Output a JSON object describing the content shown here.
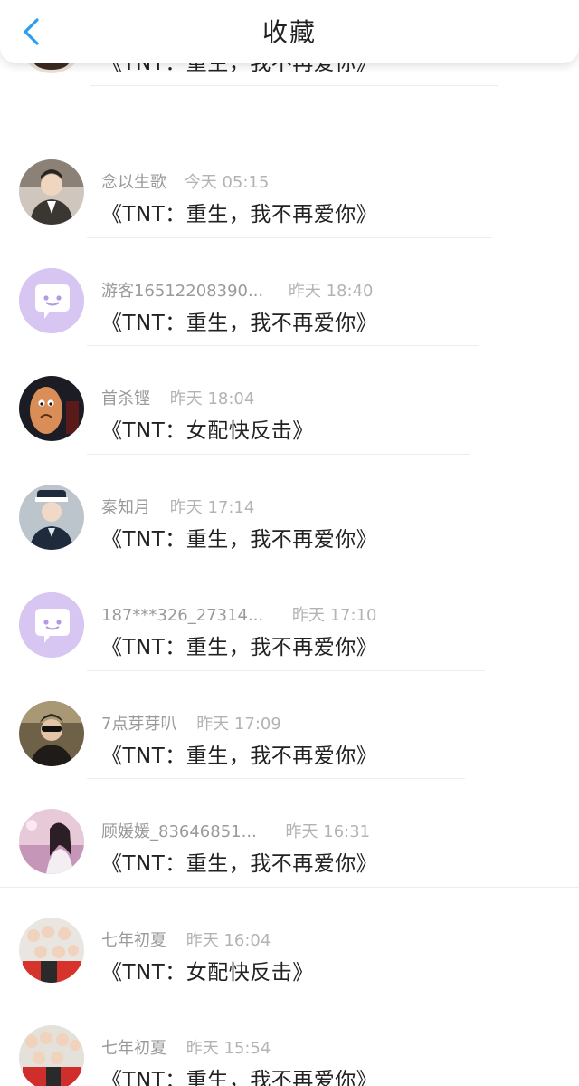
{
  "header": {
    "title": "收藏",
    "back_icon": "chevron-left-icon",
    "accent_color": "#2a9df4"
  },
  "list": [
    {
      "name": "",
      "time": "",
      "title": "《TNT：重生，我不再爱你》",
      "avatar": "photo-avatar"
    },
    {
      "name": "念以生歌",
      "time": "今天 05:15",
      "title": "《TNT：重生，我不再爱你》",
      "avatar": "photo-avatar"
    },
    {
      "name": "游客16512208390...",
      "time": "昨天 18:40",
      "title": "《TNT：重生，我不再爱你》",
      "avatar": "default-chat-avatar"
    },
    {
      "name": "首杀铿",
      "time": "昨天 18:04",
      "title": "《TNT：女配快反击》",
      "avatar": "photo-avatar"
    },
    {
      "name": "秦知月",
      "time": "昨天 17:14",
      "title": "《TNT：重生，我不再爱你》",
      "avatar": "photo-avatar"
    },
    {
      "name": "187***326_27314...",
      "time": "昨天 17:10",
      "title": "《TNT：重生，我不再爱你》",
      "avatar": "default-chat-avatar"
    },
    {
      "name": "7点芽芽叭",
      "time": "昨天 17:09",
      "title": "《TNT：重生，我不再爱你》",
      "avatar": "photo-avatar"
    },
    {
      "name": "顾媛媛_83646851...",
      "time": "昨天 16:31",
      "title": "《TNT：重生，我不再爱你》",
      "avatar": "photo-avatar"
    },
    {
      "name": "七年初夏",
      "time": "昨天 16:04",
      "title": "《TNT：女配快反击》",
      "avatar": "photo-avatar"
    },
    {
      "name": "七年初夏",
      "time": "昨天 15:54",
      "title": "《TNT：重生，我不再爱你》",
      "avatar": "photo-avatar"
    }
  ]
}
